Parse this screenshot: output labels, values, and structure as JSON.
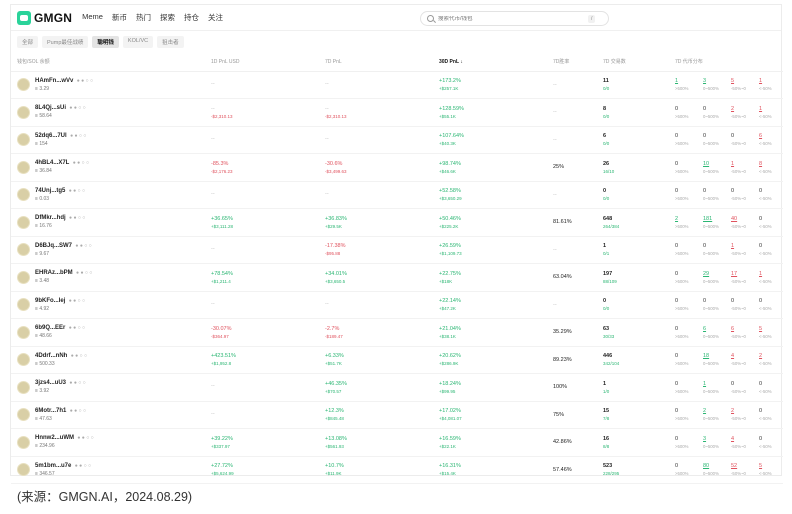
{
  "app": {
    "name": "GMGN"
  },
  "nav": [
    "Meme",
    "新币",
    "热门",
    "探索",
    "持仓",
    "关注"
  ],
  "search": {
    "placeholder": "搜索代币/钱包",
    "shortcut": "/"
  },
  "tabs": [
    {
      "label": "全部",
      "active": false
    },
    {
      "label": "Pump最佳战绩",
      "active": false
    },
    {
      "label": "聪明钱",
      "active": true
    },
    {
      "label": "KOL/VC",
      "active": false
    },
    {
      "label": "狙击者",
      "active": false
    }
  ],
  "columns": [
    "钱包/SOL 余额",
    "1D PnL  USD",
    "7D PnL",
    "30D PnL",
    "7D胜率",
    "7D 交易数",
    "7D 代币分布"
  ],
  "dist_labels": [
    ">500%",
    "0~500%",
    "-50%~0",
    "<-50%"
  ],
  "rows": [
    {
      "name": "HAmFn...wVv",
      "bal": "3.29",
      "pnl1": "--",
      "pnl1u": "",
      "pnl1c": "dim",
      "pnl7": "--",
      "pnl7u": "",
      "pnl7c": "dim",
      "pnl30": "+173.2%",
      "pnl30u": "+$257.1K",
      "win": "--",
      "tx": "11",
      "txs": "0/0",
      "dist": [
        "1",
        "3",
        "5",
        "1"
      ]
    },
    {
      "name": "8L4Qj...sUi",
      "bal": "58.64",
      "pnl1": "--",
      "pnl1u": "-$2,310.13",
      "pnl1c": "dim",
      "pnl7": "--",
      "pnl7u": "-$2,310.13",
      "pnl7c": "dim",
      "pnl30": "+128.59%",
      "pnl30u": "+$55.1K",
      "win": "--",
      "tx": "8",
      "txs": "0/0",
      "dist": [
        "0",
        "0",
        "2",
        "1"
      ]
    },
    {
      "name": "52dq6...7Ul",
      "bal": "154",
      "pnl1": "--",
      "pnl1u": "",
      "pnl1c": "dim",
      "pnl7": "--",
      "pnl7u": "",
      "pnl7c": "dim",
      "pnl30": "+107.64%",
      "pnl30u": "+$40.3K",
      "win": "--",
      "tx": "6",
      "txs": "0/0",
      "dist": [
        "0",
        "0",
        "0",
        "6"
      ]
    },
    {
      "name": "4hBL4...X7L",
      "bal": "36.84",
      "pnl1": "-85.3%",
      "pnl1u": "-$2,176.23",
      "pnl1c": "r",
      "pnl7": "-30.6%",
      "pnl7u": "-$3,499.63",
      "pnl7c": "r",
      "pnl30": "+98.74%",
      "pnl30u": "+$46.6K",
      "win": "25%",
      "tx": "26",
      "txs": "16/10",
      "dist": [
        "0",
        "10",
        "1",
        "8"
      ]
    },
    {
      "name": "74Unj...tg5",
      "bal": "0.03",
      "pnl1": "--",
      "pnl1u": "",
      "pnl1c": "dim",
      "pnl7": "--",
      "pnl7u": "",
      "pnl7c": "dim",
      "pnl30": "+52.58%",
      "pnl30u": "+$3,650.29",
      "win": "--",
      "tx": "0",
      "txs": "0/0",
      "dist": [
        "0",
        "0",
        "0",
        "0"
      ]
    },
    {
      "name": "DfMkr...hdj",
      "bal": "16.76",
      "pnl1": "+36.65%",
      "pnl1u": "+$3,111.28",
      "pnl1c": "g",
      "pnl7": "+36.83%",
      "pnl7u": "+$29.5K",
      "pnl7c": "g",
      "pnl30": "+50.46%",
      "pnl30u": "+$225.2K",
      "win": "81.61%",
      "tx": "648",
      "txs": "264/384",
      "dist": [
        "2",
        "181",
        "40",
        "0"
      ]
    },
    {
      "name": "D6BJq...SW7",
      "bal": "9.67",
      "pnl1": "--",
      "pnl1u": "",
      "pnl1c": "dim",
      "pnl7": "-17.38%",
      "pnl7u": "-$95.88",
      "pnl7c": "r",
      "pnl30": "+26.59%",
      "pnl30u": "+$1,109.73",
      "win": "--",
      "tx": "1",
      "txs": "0/1",
      "dist": [
        "0",
        "0",
        "1",
        "0"
      ]
    },
    {
      "name": "EHRAz...bPM",
      "bal": "3.48",
      "pnl1": "+78.54%",
      "pnl1u": "+$1,211.4",
      "pnl1c": "g",
      "pnl7": "+34.01%",
      "pnl7u": "+$3,650.5",
      "pnl7c": "g",
      "pnl30": "+22.75%",
      "pnl30u": "+$18K",
      "win": "63.04%",
      "tx": "197",
      "txs": "88/109",
      "dist": [
        "0",
        "29",
        "17",
        "1"
      ]
    },
    {
      "name": "9bKFo...Iej",
      "bal": "4.92",
      "pnl1": "--",
      "pnl1u": "",
      "pnl1c": "dim",
      "pnl7": "--",
      "pnl7u": "",
      "pnl7c": "dim",
      "pnl30": "+22.14%",
      "pnl30u": "+$47.2K",
      "win": "--",
      "tx": "0",
      "txs": "0/0",
      "dist": [
        "0",
        "0",
        "0",
        "0"
      ]
    },
    {
      "name": "6b9Q...EEr",
      "bal": "48.66",
      "pnl1": "-30.07%",
      "pnl1u": "-$364.97",
      "pnl1c": "r",
      "pnl7": "-2.7%",
      "pnl7u": "-$189.47",
      "pnl7c": "r",
      "pnl30": "+21.04%",
      "pnl30u": "+$38.1K",
      "win": "35.29%",
      "tx": "63",
      "txs": "30/33",
      "dist": [
        "0",
        "6",
        "6",
        "5"
      ]
    },
    {
      "name": "4Ddrf...nNh",
      "bal": "500.33",
      "pnl1": "+423.51%",
      "pnl1u": "+$1,952.8",
      "pnl1c": "g",
      "pnl7": "+6.33%",
      "pnl7u": "+$51.7K",
      "pnl7c": "g",
      "pnl30": "+20.62%",
      "pnl30u": "+$286.9K",
      "win": "89.23%",
      "tx": "446",
      "txs": "342/104",
      "dist": [
        "0",
        "18",
        "4",
        "2"
      ]
    },
    {
      "name": "3jzs4...uU3",
      "bal": "3.92",
      "pnl1": "--",
      "pnl1u": "",
      "pnl1c": "dim",
      "pnl7": "+46.35%",
      "pnl7u": "+$70.57",
      "pnl7c": "g",
      "pnl30": "+18.24%",
      "pnl30u": "+$99.95",
      "win": "100%",
      "tx": "1",
      "txs": "1/0",
      "dist": [
        "0",
        "1",
        "0",
        "0"
      ]
    },
    {
      "name": "6Motr...7h1",
      "bal": "47.63",
      "pnl1": "--",
      "pnl1u": "",
      "pnl1c": "dim",
      "pnl7": "+12.3%",
      "pnl7u": "+$845.48",
      "pnl7c": "g",
      "pnl30": "+17.02%",
      "pnl30u": "+$4,081.07",
      "win": "75%",
      "tx": "15",
      "txs": "7/8",
      "dist": [
        "0",
        "2",
        "2",
        "0"
      ]
    },
    {
      "name": "Hnnw2...uWM",
      "bal": "234.96",
      "pnl1": "+39.22%",
      "pnl1u": "+$337.97",
      "pnl1c": "g",
      "pnl7": "+13.08%",
      "pnl7u": "+$561.93",
      "pnl7c": "g",
      "pnl30": "+16.59%",
      "pnl30u": "+$22.1K",
      "win": "42.86%",
      "tx": "16",
      "txs": "8/8",
      "dist": [
        "0",
        "3",
        "4",
        "0"
      ]
    },
    {
      "name": "5m1bm...u7e",
      "bal": "346.57",
      "pnl1": "+27.72%",
      "pnl1u": "+$5,624.99",
      "pnl1c": "g",
      "pnl7": "+10.7%",
      "pnl7u": "+$11.9K",
      "pnl7c": "g",
      "pnl30": "+16.31%",
      "pnl30u": "+$15.4K",
      "win": "57.46%",
      "tx": "523",
      "txs": "228/295",
      "dist": [
        "0",
        "80",
        "52",
        "5"
      ]
    }
  ],
  "caption": "(来源：GMGN.AI，2024.08.29)"
}
